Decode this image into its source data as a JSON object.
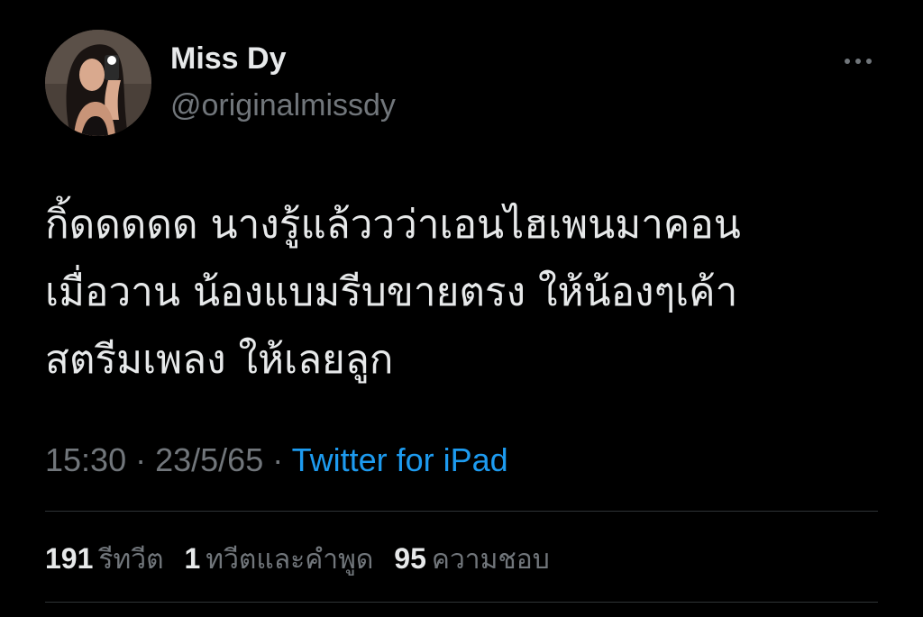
{
  "author": {
    "name": "Miss Dy",
    "handle": "@originalmissdy",
    "avatar_icon": "profile-photo"
  },
  "more_icon": "more-horizontal-icon",
  "tweet": {
    "lines": [
      "กิ้ดดดดด นางรู้แล้ววว่าเอนไฮเพนมาคอน",
      "เมื่อวาน น้องแบมรีบขายตรง ให้น้องๆเค้า",
      "สตรีมเพลง ให้เลยลูก"
    ]
  },
  "meta": {
    "time": "15:30",
    "separator": "·",
    "date": "23/5/65",
    "source": "Twitter for iPad"
  },
  "stats": {
    "retweets": {
      "count": "191",
      "label": "รีทวีต"
    },
    "quotes": {
      "count": "1",
      "label": "ทวีตและคำพูด"
    },
    "likes": {
      "count": "95",
      "label": "ความชอบ"
    }
  },
  "colors": {
    "background": "#000000",
    "text_primary": "#e7e9ea",
    "text_secondary": "#71767b",
    "link": "#1d9bf0",
    "divider": "#2f3336"
  }
}
